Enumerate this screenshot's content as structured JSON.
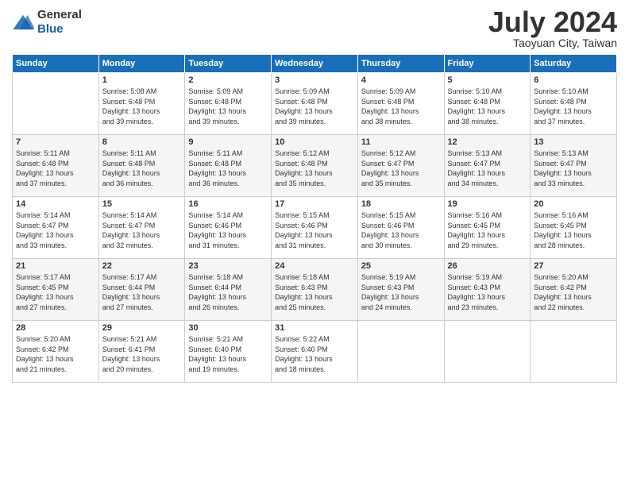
{
  "header": {
    "logo_general": "General",
    "logo_blue": "Blue",
    "month": "July 2024",
    "location": "Taoyuan City, Taiwan"
  },
  "days_of_week": [
    "Sunday",
    "Monday",
    "Tuesday",
    "Wednesday",
    "Thursday",
    "Friday",
    "Saturday"
  ],
  "weeks": [
    [
      {
        "day": "",
        "info": ""
      },
      {
        "day": "1",
        "info": "Sunrise: 5:08 AM\nSunset: 6:48 PM\nDaylight: 13 hours\nand 39 minutes."
      },
      {
        "day": "2",
        "info": "Sunrise: 5:09 AM\nSunset: 6:48 PM\nDaylight: 13 hours\nand 39 minutes."
      },
      {
        "day": "3",
        "info": "Sunrise: 5:09 AM\nSunset: 6:48 PM\nDaylight: 13 hours\nand 39 minutes."
      },
      {
        "day": "4",
        "info": "Sunrise: 5:09 AM\nSunset: 6:48 PM\nDaylight: 13 hours\nand 38 minutes."
      },
      {
        "day": "5",
        "info": "Sunrise: 5:10 AM\nSunset: 6:48 PM\nDaylight: 13 hours\nand 38 minutes."
      },
      {
        "day": "6",
        "info": "Sunrise: 5:10 AM\nSunset: 6:48 PM\nDaylight: 13 hours\nand 37 minutes."
      }
    ],
    [
      {
        "day": "7",
        "info": "Sunrise: 5:11 AM\nSunset: 6:48 PM\nDaylight: 13 hours\nand 37 minutes."
      },
      {
        "day": "8",
        "info": "Sunrise: 5:11 AM\nSunset: 6:48 PM\nDaylight: 13 hours\nand 36 minutes."
      },
      {
        "day": "9",
        "info": "Sunrise: 5:11 AM\nSunset: 6:48 PM\nDaylight: 13 hours\nand 36 minutes."
      },
      {
        "day": "10",
        "info": "Sunrise: 5:12 AM\nSunset: 6:48 PM\nDaylight: 13 hours\nand 35 minutes."
      },
      {
        "day": "11",
        "info": "Sunrise: 5:12 AM\nSunset: 6:47 PM\nDaylight: 13 hours\nand 35 minutes."
      },
      {
        "day": "12",
        "info": "Sunrise: 5:13 AM\nSunset: 6:47 PM\nDaylight: 13 hours\nand 34 minutes."
      },
      {
        "day": "13",
        "info": "Sunrise: 5:13 AM\nSunset: 6:47 PM\nDaylight: 13 hours\nand 33 minutes."
      }
    ],
    [
      {
        "day": "14",
        "info": "Sunrise: 5:14 AM\nSunset: 6:47 PM\nDaylight: 13 hours\nand 33 minutes."
      },
      {
        "day": "15",
        "info": "Sunrise: 5:14 AM\nSunset: 6:47 PM\nDaylight: 13 hours\nand 32 minutes."
      },
      {
        "day": "16",
        "info": "Sunrise: 5:14 AM\nSunset: 6:46 PM\nDaylight: 13 hours\nand 31 minutes."
      },
      {
        "day": "17",
        "info": "Sunrise: 5:15 AM\nSunset: 6:46 PM\nDaylight: 13 hours\nand 31 minutes."
      },
      {
        "day": "18",
        "info": "Sunrise: 5:15 AM\nSunset: 6:46 PM\nDaylight: 13 hours\nand 30 minutes."
      },
      {
        "day": "19",
        "info": "Sunrise: 5:16 AM\nSunset: 6:45 PM\nDaylight: 13 hours\nand 29 minutes."
      },
      {
        "day": "20",
        "info": "Sunrise: 5:16 AM\nSunset: 6:45 PM\nDaylight: 13 hours\nand 28 minutes."
      }
    ],
    [
      {
        "day": "21",
        "info": "Sunrise: 5:17 AM\nSunset: 6:45 PM\nDaylight: 13 hours\nand 27 minutes."
      },
      {
        "day": "22",
        "info": "Sunrise: 5:17 AM\nSunset: 6:44 PM\nDaylight: 13 hours\nand 27 minutes."
      },
      {
        "day": "23",
        "info": "Sunrise: 5:18 AM\nSunset: 6:44 PM\nDaylight: 13 hours\nand 26 minutes."
      },
      {
        "day": "24",
        "info": "Sunrise: 5:18 AM\nSunset: 6:43 PM\nDaylight: 13 hours\nand 25 minutes."
      },
      {
        "day": "25",
        "info": "Sunrise: 5:19 AM\nSunset: 6:43 PM\nDaylight: 13 hours\nand 24 minutes."
      },
      {
        "day": "26",
        "info": "Sunrise: 5:19 AM\nSunset: 6:43 PM\nDaylight: 13 hours\nand 23 minutes."
      },
      {
        "day": "27",
        "info": "Sunrise: 5:20 AM\nSunset: 6:42 PM\nDaylight: 13 hours\nand 22 minutes."
      }
    ],
    [
      {
        "day": "28",
        "info": "Sunrise: 5:20 AM\nSunset: 6:42 PM\nDaylight: 13 hours\nand 21 minutes."
      },
      {
        "day": "29",
        "info": "Sunrise: 5:21 AM\nSunset: 6:41 PM\nDaylight: 13 hours\nand 20 minutes."
      },
      {
        "day": "30",
        "info": "Sunrise: 5:21 AM\nSunset: 6:40 PM\nDaylight: 13 hours\nand 19 minutes."
      },
      {
        "day": "31",
        "info": "Sunrise: 5:22 AM\nSunset: 6:40 PM\nDaylight: 13 hours\nand 18 minutes."
      },
      {
        "day": "",
        "info": ""
      },
      {
        "day": "",
        "info": ""
      },
      {
        "day": "",
        "info": ""
      }
    ]
  ]
}
